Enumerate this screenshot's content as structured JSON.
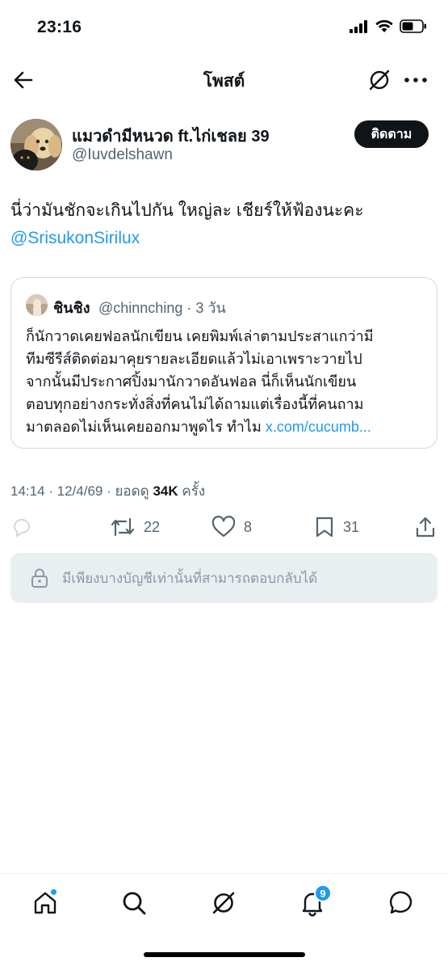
{
  "status_bar": {
    "time": "23:16"
  },
  "nav": {
    "title": "โพสต์"
  },
  "author": {
    "name": "แมวดำมีหนวด ft.ไก่เชลย 39",
    "handle": "@Iuvdelshawn",
    "follow_label": "ติดตาม"
  },
  "post": {
    "text": "นี่ว่ามันชักจะเกินไปกัน ใหญ่ละ เชียร์ให้ฟ้องนะคะ",
    "mention": "@SrisukonSirilux"
  },
  "quote": {
    "name": "ชินชิง",
    "handle_time": "@chinnching · 3 วัน",
    "lines": [
      "ก็นักวาดเคยฟอลนักเขียน เคยพิมพ์เล่าตามประสาแกว่ามี",
      "ทีมซีรีส์ติดต่อมาคุยรายละเอียดแล้วไม่เอาเพราะวายไป",
      "จากนั้นมีประกาศปิ้งมานักวาดอันฟอล นี่ก็เห็นนักเขียน",
      "ตอบทุกอย่างกระทั่งสิ่งที่คนไม่ได้ถามแต่เรื่องนี้ที่คนถาม"
    ],
    "last_line": "มาตลอดไม่เห็นเคยออกมาพูดไร ทำไม ",
    "link": "x.com/cucumb..."
  },
  "meta": {
    "datetime": "14:14 · 12/4/69 · ยอดดู ",
    "views": "34K",
    "views_suffix": " ครั้ง"
  },
  "actions": {
    "reposts": "22",
    "likes": "8",
    "bookmarks": "31"
  },
  "restricted": {
    "text": "มีเพียงบางบัญชีเท่านั้นที่สามารถตอบกลับได้"
  },
  "tabbar": {
    "notifications_badge": "9"
  },
  "colors": {
    "accent": "#1d9bf0",
    "text": "#0f1419",
    "muted": "#536471"
  },
  "icons": [
    "back-icon",
    "grok-icon",
    "more-icon",
    "reply-icon",
    "repost-icon",
    "like-icon",
    "bookmark-icon",
    "share-icon",
    "lock-icon",
    "home-icon",
    "search-icon",
    "grok-tab-icon",
    "bell-icon",
    "messages-icon"
  ]
}
